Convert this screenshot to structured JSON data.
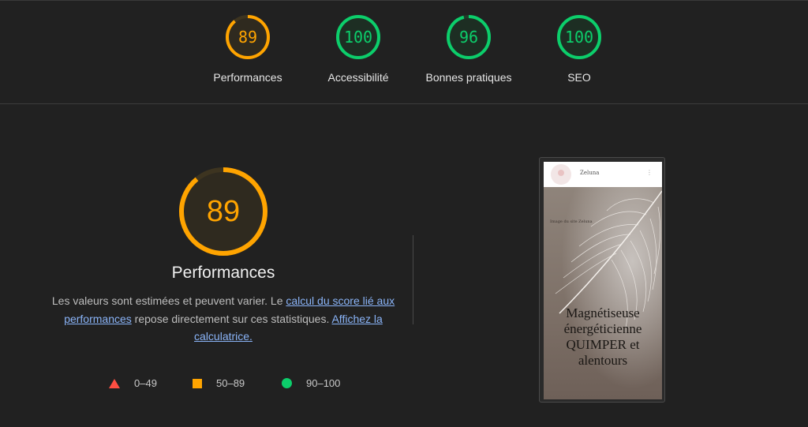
{
  "colors": {
    "background": "#212121",
    "fail": "#ff4e42",
    "average": "#ffa400",
    "pass": "#0cce6b",
    "link": "#8ab4f8"
  },
  "categories": [
    {
      "score": 89,
      "label": "Performances",
      "status": "average"
    },
    {
      "score": 100,
      "label": "Accessibilité",
      "status": "pass"
    },
    {
      "score": 96,
      "label": "Bonnes pratiques",
      "status": "pass"
    },
    {
      "score": 100,
      "label": "SEO",
      "status": "pass"
    }
  ],
  "main": {
    "score": 89,
    "title": "Performances",
    "desc_part1": "Les valeurs sont estimées et peuvent varier. Le ",
    "link1": "calcul du score lié aux performances",
    "desc_part2": " repose directement sur ces statistiques. ",
    "link2": "Affichez la calculatrice."
  },
  "legend": [
    {
      "range": "0–49",
      "icon": "triangle-icon"
    },
    {
      "range": "50–89",
      "icon": "square-icon"
    },
    {
      "range": "90–100",
      "icon": "circle-icon"
    }
  ],
  "screenshot": {
    "site_name": "Zeluna",
    "menu_glyph": "⋮",
    "image_alt": "Image du site Zeluna",
    "heading": "Magnétiseuse énergéticienne QUIMPER et alentours"
  }
}
